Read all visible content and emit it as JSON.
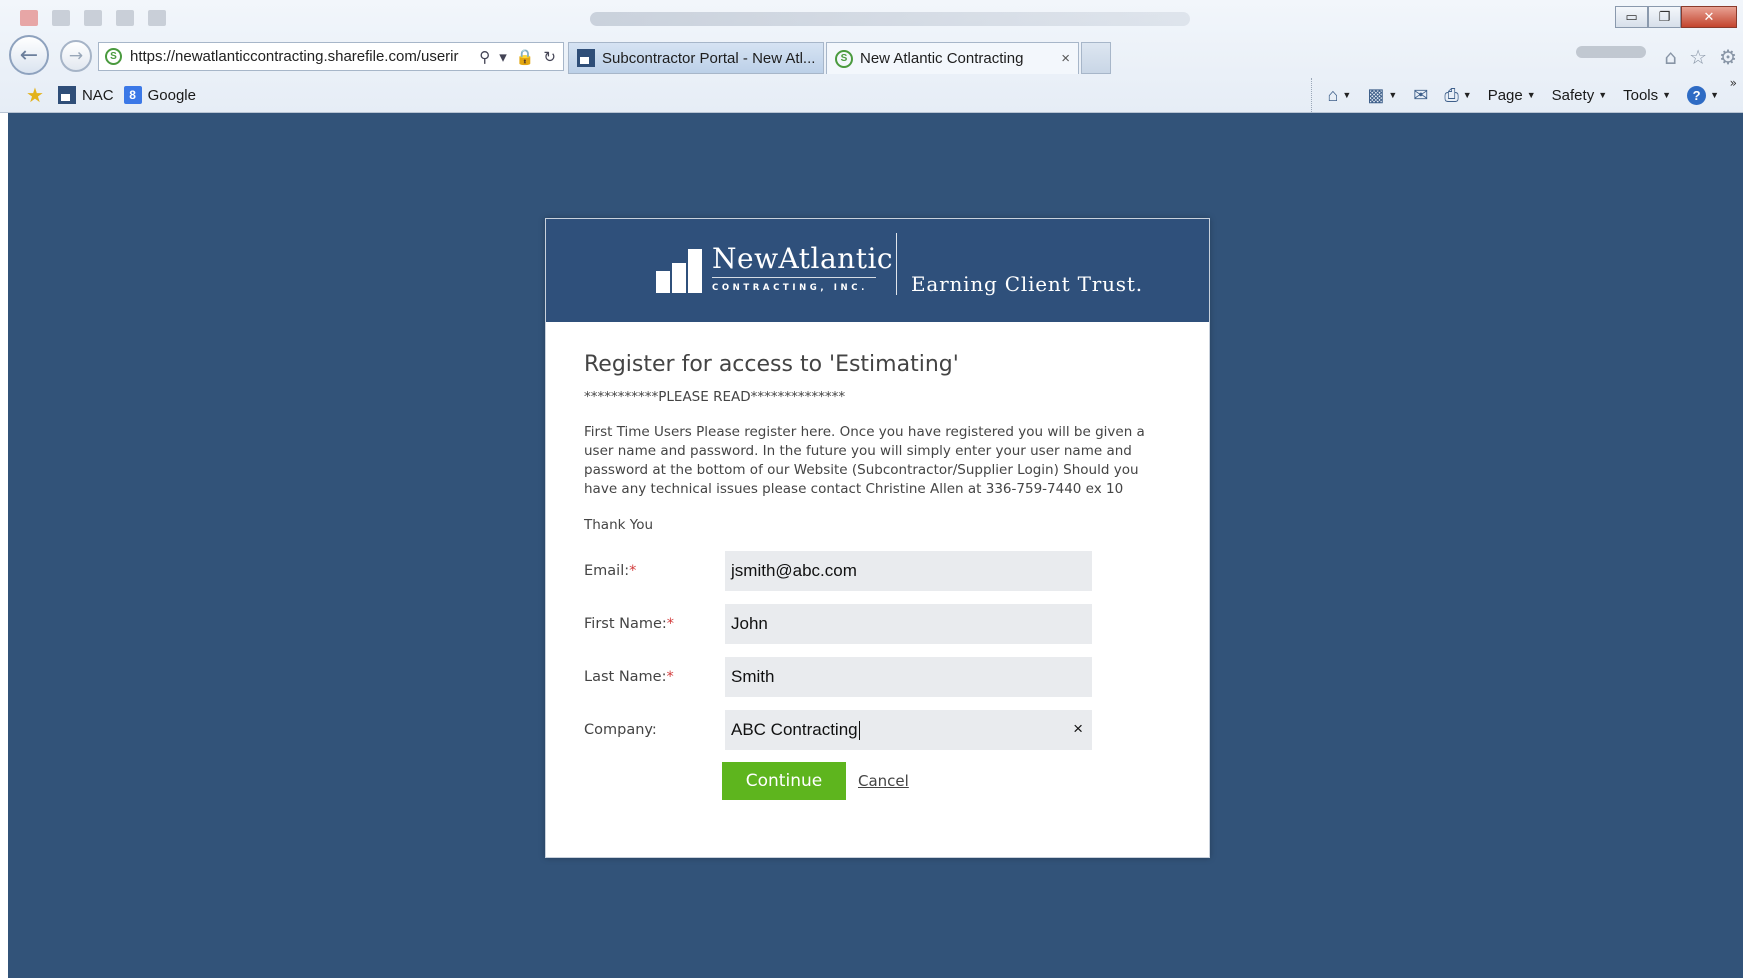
{
  "browser": {
    "address_url": "https://newatlanticcontracting.sharefile.com/userir",
    "tabs": [
      {
        "label": "Subcontractor Portal - New Atl..."
      },
      {
        "label": "New Atlantic Contracting",
        "close": "×"
      }
    ],
    "favorites": [
      {
        "label": "NAC"
      },
      {
        "label": "Google"
      }
    ],
    "commands": {
      "page": "Page",
      "safety": "Safety",
      "tools": "Tools",
      "help": "?"
    },
    "window_controls": {
      "minimize": "▭",
      "restore": "❐",
      "close": "✕"
    }
  },
  "brand": {
    "name": "NewAtlantic",
    "sub": "CONTRACTING, INC.",
    "tagline": "Earning Client Trust."
  },
  "form": {
    "title": "Register for access to 'Estimating'",
    "notice": "***********PLEASE READ**************",
    "instructions": "First Time Users Please register here. Once you have registered you will be given a user name and password. In the future you will simply enter your user name and password at the bottom of our Website (Subcontractor/Supplier Login) Should you have any technical issues please contact Christine Allen at 336-759-7440 ex 10",
    "thanks": "Thank You",
    "fields": {
      "email": {
        "label": "Email:",
        "required": "*",
        "value": "jsmith@abc.com"
      },
      "first_name": {
        "label": "First Name:",
        "required": "*",
        "value": "John"
      },
      "last_name": {
        "label": "Last Name:",
        "required": "*",
        "value": "Smith"
      },
      "company": {
        "label": "Company:",
        "value": "ABC Contracting",
        "clear": "×"
      }
    },
    "continue_label": "Continue",
    "cancel_label": "Cancel"
  },
  "colors": {
    "page_background": "#325379",
    "header_background": "#2f507b",
    "continue_button": "#5eb51e",
    "required_marker": "#d23b3b"
  }
}
